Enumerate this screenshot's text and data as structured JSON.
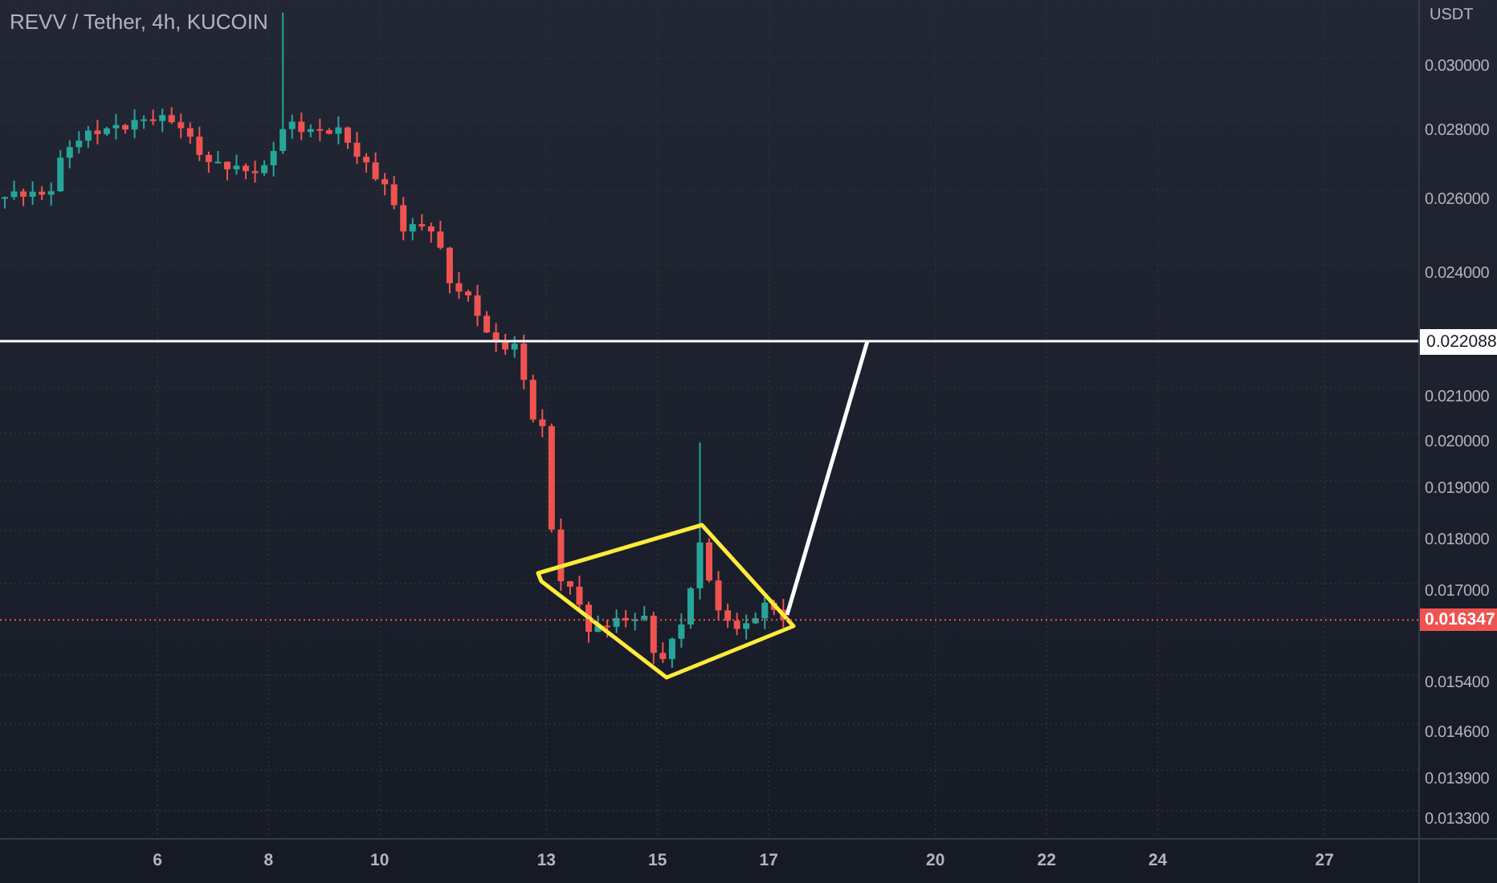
{
  "chart": {
    "title": "REVV / Tether, 4h, KUCOIN",
    "price_axis": {
      "unit": "USDT",
      "labels": [
        "0.030000",
        "0.028000",
        "0.026000",
        "0.024000",
        "0.021000",
        "0.020000",
        "0.019000",
        "0.018000",
        "0.017000",
        "0.015400",
        "0.014600",
        "0.013900",
        "0.013300"
      ]
    },
    "time_axis": {
      "labels": [
        "6",
        "8",
        "10",
        "13",
        "15",
        "17",
        "20",
        "22",
        "24",
        "27"
      ]
    },
    "price_lines": [
      {
        "kind": "level",
        "label": "0.022088"
      },
      {
        "kind": "last",
        "label": "0.016347"
      }
    ]
  }
}
